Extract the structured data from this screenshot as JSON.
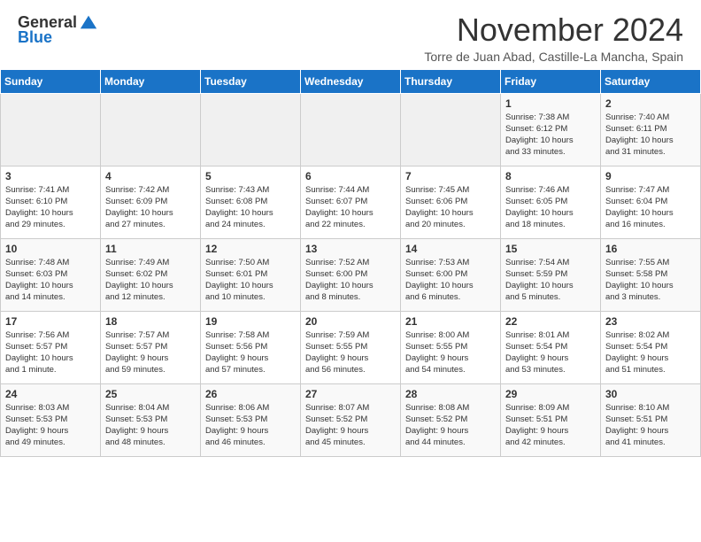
{
  "header": {
    "logo_general": "General",
    "logo_blue": "Blue",
    "month": "November 2024",
    "location": "Torre de Juan Abad, Castille-La Mancha, Spain"
  },
  "weekdays": [
    "Sunday",
    "Monday",
    "Tuesday",
    "Wednesday",
    "Thursday",
    "Friday",
    "Saturday"
  ],
  "weeks": [
    [
      {
        "day": "",
        "info": ""
      },
      {
        "day": "",
        "info": ""
      },
      {
        "day": "",
        "info": ""
      },
      {
        "day": "",
        "info": ""
      },
      {
        "day": "",
        "info": ""
      },
      {
        "day": "1",
        "info": "Sunrise: 7:38 AM\nSunset: 6:12 PM\nDaylight: 10 hours\nand 33 minutes."
      },
      {
        "day": "2",
        "info": "Sunrise: 7:40 AM\nSunset: 6:11 PM\nDaylight: 10 hours\nand 31 minutes."
      }
    ],
    [
      {
        "day": "3",
        "info": "Sunrise: 7:41 AM\nSunset: 6:10 PM\nDaylight: 10 hours\nand 29 minutes."
      },
      {
        "day": "4",
        "info": "Sunrise: 7:42 AM\nSunset: 6:09 PM\nDaylight: 10 hours\nand 27 minutes."
      },
      {
        "day": "5",
        "info": "Sunrise: 7:43 AM\nSunset: 6:08 PM\nDaylight: 10 hours\nand 24 minutes."
      },
      {
        "day": "6",
        "info": "Sunrise: 7:44 AM\nSunset: 6:07 PM\nDaylight: 10 hours\nand 22 minutes."
      },
      {
        "day": "7",
        "info": "Sunrise: 7:45 AM\nSunset: 6:06 PM\nDaylight: 10 hours\nand 20 minutes."
      },
      {
        "day": "8",
        "info": "Sunrise: 7:46 AM\nSunset: 6:05 PM\nDaylight: 10 hours\nand 18 minutes."
      },
      {
        "day": "9",
        "info": "Sunrise: 7:47 AM\nSunset: 6:04 PM\nDaylight: 10 hours\nand 16 minutes."
      }
    ],
    [
      {
        "day": "10",
        "info": "Sunrise: 7:48 AM\nSunset: 6:03 PM\nDaylight: 10 hours\nand 14 minutes."
      },
      {
        "day": "11",
        "info": "Sunrise: 7:49 AM\nSunset: 6:02 PM\nDaylight: 10 hours\nand 12 minutes."
      },
      {
        "day": "12",
        "info": "Sunrise: 7:50 AM\nSunset: 6:01 PM\nDaylight: 10 hours\nand 10 minutes."
      },
      {
        "day": "13",
        "info": "Sunrise: 7:52 AM\nSunset: 6:00 PM\nDaylight: 10 hours\nand 8 minutes."
      },
      {
        "day": "14",
        "info": "Sunrise: 7:53 AM\nSunset: 6:00 PM\nDaylight: 10 hours\nand 6 minutes."
      },
      {
        "day": "15",
        "info": "Sunrise: 7:54 AM\nSunset: 5:59 PM\nDaylight: 10 hours\nand 5 minutes."
      },
      {
        "day": "16",
        "info": "Sunrise: 7:55 AM\nSunset: 5:58 PM\nDaylight: 10 hours\nand 3 minutes."
      }
    ],
    [
      {
        "day": "17",
        "info": "Sunrise: 7:56 AM\nSunset: 5:57 PM\nDaylight: 10 hours\nand 1 minute."
      },
      {
        "day": "18",
        "info": "Sunrise: 7:57 AM\nSunset: 5:57 PM\nDaylight: 9 hours\nand 59 minutes."
      },
      {
        "day": "19",
        "info": "Sunrise: 7:58 AM\nSunset: 5:56 PM\nDaylight: 9 hours\nand 57 minutes."
      },
      {
        "day": "20",
        "info": "Sunrise: 7:59 AM\nSunset: 5:55 PM\nDaylight: 9 hours\nand 56 minutes."
      },
      {
        "day": "21",
        "info": "Sunrise: 8:00 AM\nSunset: 5:55 PM\nDaylight: 9 hours\nand 54 minutes."
      },
      {
        "day": "22",
        "info": "Sunrise: 8:01 AM\nSunset: 5:54 PM\nDaylight: 9 hours\nand 53 minutes."
      },
      {
        "day": "23",
        "info": "Sunrise: 8:02 AM\nSunset: 5:54 PM\nDaylight: 9 hours\nand 51 minutes."
      }
    ],
    [
      {
        "day": "24",
        "info": "Sunrise: 8:03 AM\nSunset: 5:53 PM\nDaylight: 9 hours\nand 49 minutes."
      },
      {
        "day": "25",
        "info": "Sunrise: 8:04 AM\nSunset: 5:53 PM\nDaylight: 9 hours\nand 48 minutes."
      },
      {
        "day": "26",
        "info": "Sunrise: 8:06 AM\nSunset: 5:53 PM\nDaylight: 9 hours\nand 46 minutes."
      },
      {
        "day": "27",
        "info": "Sunrise: 8:07 AM\nSunset: 5:52 PM\nDaylight: 9 hours\nand 45 minutes."
      },
      {
        "day": "28",
        "info": "Sunrise: 8:08 AM\nSunset: 5:52 PM\nDaylight: 9 hours\nand 44 minutes."
      },
      {
        "day": "29",
        "info": "Sunrise: 8:09 AM\nSunset: 5:51 PM\nDaylight: 9 hours\nand 42 minutes."
      },
      {
        "day": "30",
        "info": "Sunrise: 8:10 AM\nSunset: 5:51 PM\nDaylight: 9 hours\nand 41 minutes."
      }
    ]
  ]
}
